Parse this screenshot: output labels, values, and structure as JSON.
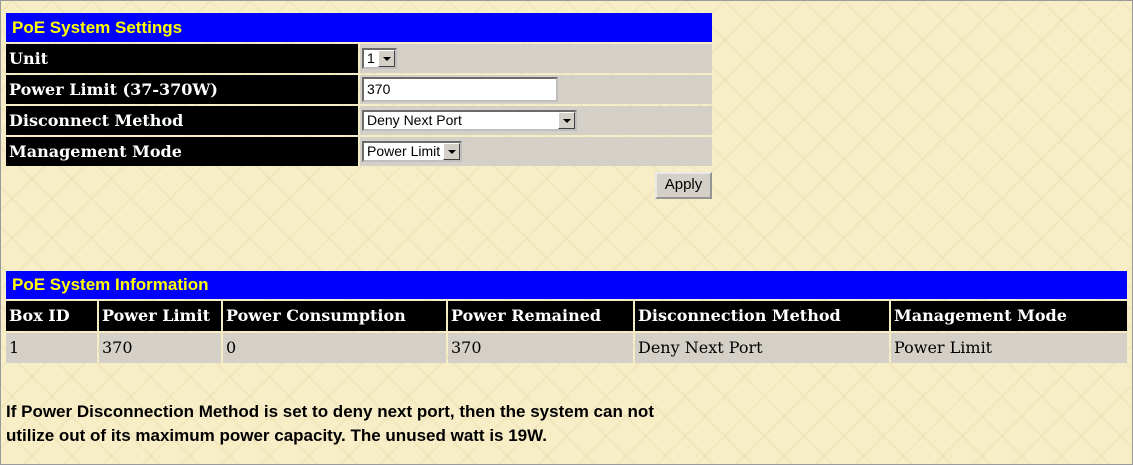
{
  "settings": {
    "title": "PoE System Settings",
    "rows": [
      {
        "label": "Unit",
        "value": "1"
      },
      {
        "label": "Power Limit (37-370W)",
        "value": "370"
      },
      {
        "label": "Disconnect Method",
        "value": "Deny Next Port"
      },
      {
        "label": "Management Mode",
        "value": "Power Limit"
      }
    ],
    "apply_label": "Apply"
  },
  "info": {
    "title": "PoE System Information",
    "headers": [
      "Box ID",
      "Power Limit",
      "Power Consumption",
      "Power Remained",
      "Disconnection Method",
      "Management Mode"
    ],
    "rows": [
      [
        "1",
        "370",
        "0",
        "370",
        "Deny Next Port",
        "Power Limit"
      ]
    ]
  },
  "note": {
    "line1": "If Power Disconnection Method is set to deny next port, then the system can not",
    "line2": "utilize out of its maximum power capacity. The unused watt is 19W."
  },
  "colors": {
    "title_bg": "#0000ff",
    "title_fg": "#ffff00",
    "label_bg": "#000000",
    "value_bg": "#d4d0c8",
    "page_bg": "#f7eec7"
  }
}
